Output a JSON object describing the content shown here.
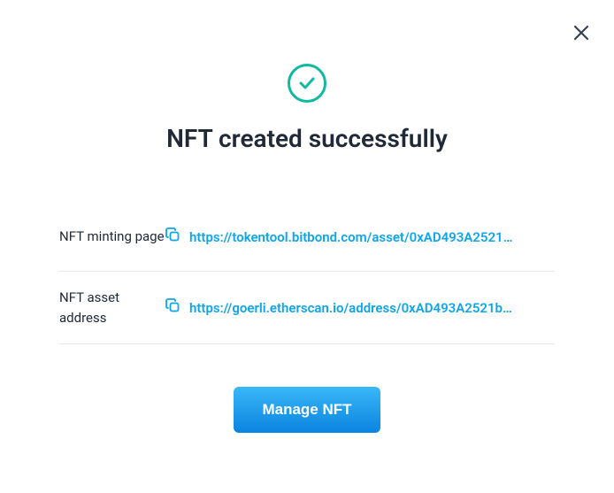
{
  "title": "NFT created successfully",
  "rows": [
    {
      "label": "NFT minting page",
      "url": "https://tokentool.bitbond.com/asset/0xAD493A2521…"
    },
    {
      "label": "NFT asset address",
      "url": "https://goerli.etherscan.io/address/0xAD493A2521b…"
    }
  ],
  "manage_button": "Manage NFT",
  "colors": {
    "accent": "#10b9a0",
    "link": "#0ea5e9"
  }
}
